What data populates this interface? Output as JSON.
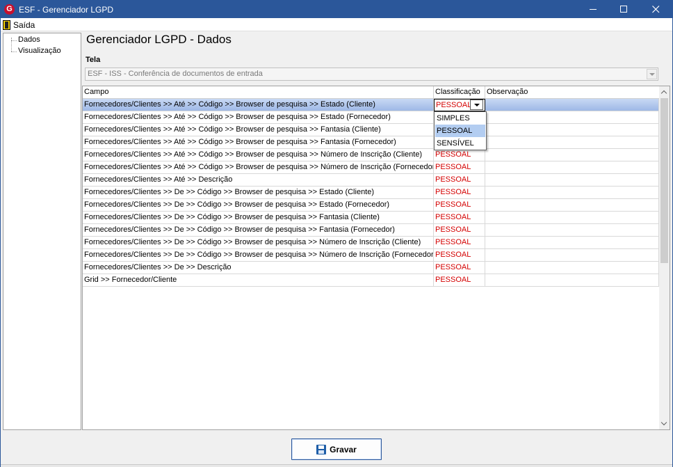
{
  "window": {
    "title": "ESF - Gerenciador LGPD",
    "icon_letter": "G",
    "minimize": "–",
    "close": "✕"
  },
  "menu": {
    "items": [
      {
        "label": "Saída"
      }
    ]
  },
  "tree": {
    "items": [
      {
        "label": "Dados"
      },
      {
        "label": "Visualização"
      }
    ]
  },
  "page": {
    "title": "Gerenciador LGPD - Dados",
    "tela_label": "Tela",
    "tela_value": "ESF - ISS - Conferência de documentos de entrada"
  },
  "grid": {
    "columns": [
      "Campo",
      "Classificação",
      "Observação"
    ],
    "rows": [
      {
        "campo": "Fornecedores/Clientes >> Até >> Código >> Browser de pesquisa >> Estado (Cliente)",
        "classificacao": "PESSOAL",
        "observacao": ""
      },
      {
        "campo": "Fornecedores/Clientes >> Até >> Código >> Browser de pesquisa >> Estado (Fornecedor)",
        "classificacao": "",
        "observacao": ""
      },
      {
        "campo": "Fornecedores/Clientes >> Até >> Código >> Browser de pesquisa >> Fantasia (Cliente)",
        "classificacao": "",
        "observacao": ""
      },
      {
        "campo": "Fornecedores/Clientes >> Até >> Código >> Browser de pesquisa >> Fantasia (Fornecedor)",
        "classificacao": "",
        "observacao": ""
      },
      {
        "campo": "Fornecedores/Clientes >> Até >> Código >> Browser de pesquisa >> Número de Inscrição (Cliente)",
        "classificacao": "PESSOAL",
        "observacao": ""
      },
      {
        "campo": "Fornecedores/Clientes >> Até >> Código >> Browser de pesquisa >> Número de Inscrição (Fornecedor)",
        "classificacao": "PESSOAL",
        "observacao": ""
      },
      {
        "campo": "Fornecedores/Clientes >> Até >> Descrição",
        "classificacao": "PESSOAL",
        "observacao": ""
      },
      {
        "campo": "Fornecedores/Clientes >> De >> Código >> Browser de pesquisa >> Estado (Cliente)",
        "classificacao": "PESSOAL",
        "observacao": ""
      },
      {
        "campo": "Fornecedores/Clientes >> De >> Código >> Browser de pesquisa >> Estado (Fornecedor)",
        "classificacao": "PESSOAL",
        "observacao": ""
      },
      {
        "campo": "Fornecedores/Clientes >> De >> Código >> Browser de pesquisa >> Fantasia (Cliente)",
        "classificacao": "PESSOAL",
        "observacao": ""
      },
      {
        "campo": "Fornecedores/Clientes >> De >> Código >> Browser de pesquisa >> Fantasia (Fornecedor)",
        "classificacao": "PESSOAL",
        "observacao": ""
      },
      {
        "campo": "Fornecedores/Clientes >> De >> Código >> Browser de pesquisa >> Número de Inscrição (Cliente)",
        "classificacao": "PESSOAL",
        "observacao": ""
      },
      {
        "campo": "Fornecedores/Clientes >> De >> Código >> Browser de pesquisa >> Número de Inscrição (Fornecedor)",
        "classificacao": "PESSOAL",
        "observacao": ""
      },
      {
        "campo": "Fornecedores/Clientes >> De >> Descrição",
        "classificacao": "PESSOAL",
        "observacao": ""
      },
      {
        "campo": "Grid >> Fornecedor/Cliente",
        "classificacao": "PESSOAL",
        "observacao": ""
      }
    ],
    "dropdown_options": [
      "SIMPLES",
      "PESSOAL",
      "SENSÍVEL"
    ],
    "dropdown_highlighted": "PESSOAL"
  },
  "footer": {
    "save_label": "Gravar"
  },
  "colors": {
    "titlebar": "#2b579a",
    "classification_text": "#d40000",
    "selected_row": "#9eb8e6",
    "dropdown_highlight": "#b3cdf1"
  },
  "icons": {
    "app": "app-logo-icon",
    "menu_saida": "exit-door-icon",
    "save": "floppy-disk-icon"
  }
}
